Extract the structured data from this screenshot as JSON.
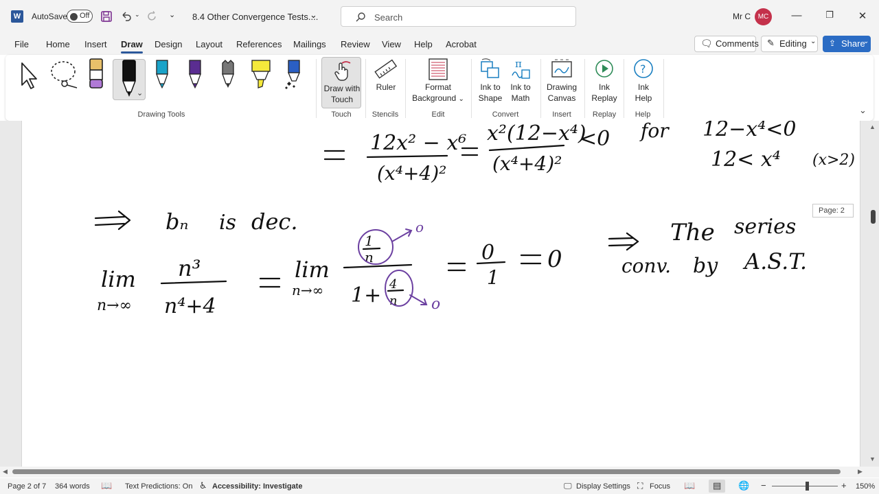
{
  "titlebar": {
    "autosave_label": "AutoSave",
    "autosave_state": "Off",
    "doc_title": "8.4 Other Convergence Tests....",
    "search_placeholder": "Search",
    "user_name": "Mr C",
    "user_initials": "MC"
  },
  "menu": {
    "tabs": [
      "File",
      "Home",
      "Insert",
      "Draw",
      "Design",
      "Layout",
      "References",
      "Mailings",
      "Review",
      "View",
      "Help",
      "Acrobat"
    ],
    "active": "Draw",
    "comments": "Comments",
    "editing": "Editing",
    "share": "Share"
  },
  "ribbon": {
    "draw_with_touch": [
      "Draw with",
      "Touch"
    ],
    "ruler": "Ruler",
    "format_background": [
      "Format",
      "Background"
    ],
    "ink_to_shape": [
      "Ink to",
      "Shape"
    ],
    "ink_to_math": [
      "Ink to",
      "Math"
    ],
    "drawing_canvas": [
      "Drawing",
      "Canvas"
    ],
    "ink_replay": [
      "Ink",
      "Replay"
    ],
    "ink_help": [
      "Ink",
      "Help"
    ],
    "groups": {
      "drawing_tools": "Drawing Tools",
      "touch": "Touch",
      "stencils": "Stencils",
      "edit": "Edit",
      "convert": "Convert",
      "insert": "Insert",
      "replay": "Replay",
      "help": "Help"
    },
    "pen_colors": [
      "#e8c06a",
      "#111111",
      "#1aa3c9",
      "#5a2d91",
      "#333333",
      "#f5e93b",
      "#2b5fc4"
    ]
  },
  "document": {
    "page_tooltip": "Page: 2"
  },
  "status": {
    "page": "Page 2 of 7",
    "words": "364 words",
    "text_predictions": "Text Predictions: On",
    "accessibility": "Accessibility: Investigate",
    "display_settings": "Display Settings",
    "focus": "Focus",
    "zoom": "150%"
  }
}
